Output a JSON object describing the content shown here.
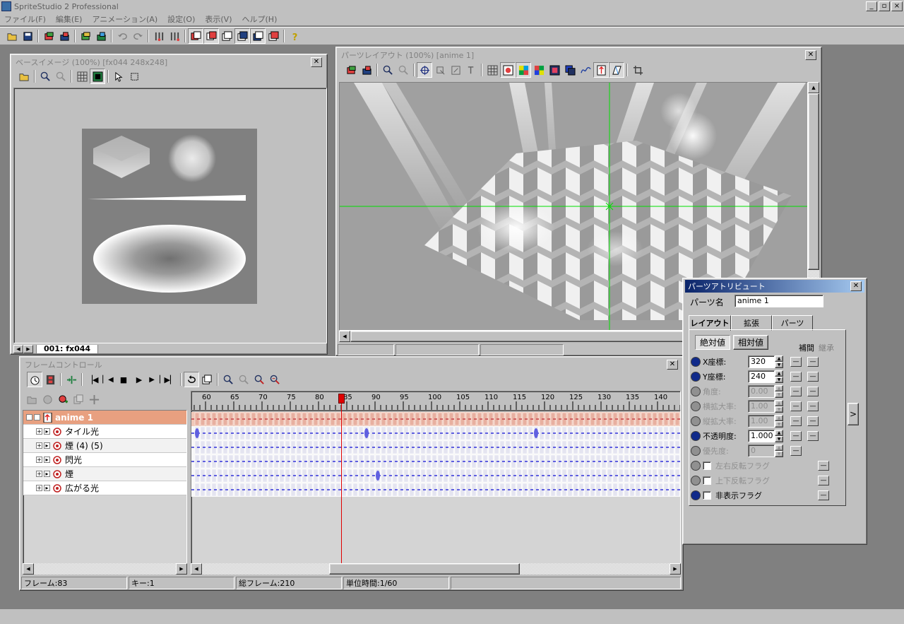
{
  "app": {
    "title": "SpriteStudio 2 Professional",
    "title_buttons": [
      "_",
      "▫",
      "×"
    ],
    "menu": [
      "ファイル(F)",
      "編集(E)",
      "アニメーション(A)",
      "設定(O)",
      "表示(V)",
      "ヘルプ(H)"
    ]
  },
  "main_toolbar": {
    "icons": [
      "open-icon",
      "save-icon",
      "import-icon",
      "export-icon",
      "palette-import-icon",
      "palette-export-icon",
      "undo-icon",
      "redo-icon",
      "tool-a-icon",
      "tool-b-icon",
      "window-1-icon",
      "window-2-icon",
      "window-3-icon",
      "window-4-icon",
      "window-5-icon",
      "window-6-icon",
      "help-icon"
    ]
  },
  "base_image": {
    "title": "ベースイメージ (100%) [fx044  248x248]",
    "tab_label": "001: fx044"
  },
  "parts_layout": {
    "title": "パーツレイアウト (100%) [anime 1]"
  },
  "attributes": {
    "title": "パーツアトリビュート",
    "part_name_label": "パーツ名",
    "part_name_value": "anime 1",
    "tabs": [
      "レイアウト",
      "拡張",
      "パーツ"
    ],
    "mode_buttons": [
      "絶対値",
      "相対値"
    ],
    "col_interp": "補間",
    "col_inherit": "継承",
    "rows": [
      {
        "label": "X座標:",
        "value": "320",
        "enabled": true
      },
      {
        "label": "Y座標:",
        "value": "240",
        "enabled": true
      },
      {
        "label": "角度:",
        "value": "0.00",
        "enabled": false
      },
      {
        "label": "横拡大率:",
        "value": "1.00",
        "enabled": false
      },
      {
        "label": "縦拡大率:",
        "value": "1.00",
        "enabled": false
      },
      {
        "label": "不透明度:",
        "value": "1.000",
        "enabled": true
      },
      {
        "label": "優先度:",
        "value": "0",
        "enabled": false
      }
    ],
    "flags": [
      {
        "label": "左右反転フラグ",
        "enabled": false
      },
      {
        "label": "上下反転フラグ",
        "enabled": false
      },
      {
        "label": "非表示フラグ",
        "enabled": true
      }
    ],
    "side_button": ">"
  },
  "frame_control": {
    "title": "フレームコントロール",
    "ruler_labels": [
      "60",
      "65",
      "70",
      "75",
      "80",
      "85",
      "90",
      "95",
      "100",
      "105",
      "110",
      "115",
      "120",
      "125",
      "130",
      "135",
      "140"
    ],
    "current_frame": 83,
    "tracks": [
      {
        "name": "anime 1",
        "root": true
      },
      {
        "name": "タイル光"
      },
      {
        "name": "煙 (4) (5)"
      },
      {
        "name": "閃光"
      },
      {
        "name": "煙"
      },
      {
        "name": "広がる光"
      }
    ],
    "keyframes": [
      [],
      [
        58,
        88,
        118
      ],
      [],
      [],
      [
        90
      ],
      []
    ],
    "status": {
      "frame": "フレーム:83",
      "key": "キー:1",
      "total": "総フレーム:210",
      "unit": "単位時間:1/60"
    }
  },
  "colors": {
    "title_active": "#0a246a",
    "title_active_end": "#a6caf0",
    "track_root": "#e8a080",
    "playhead": "#e00000",
    "keyframe": "#6060e0",
    "crosshair": "#00e000"
  }
}
